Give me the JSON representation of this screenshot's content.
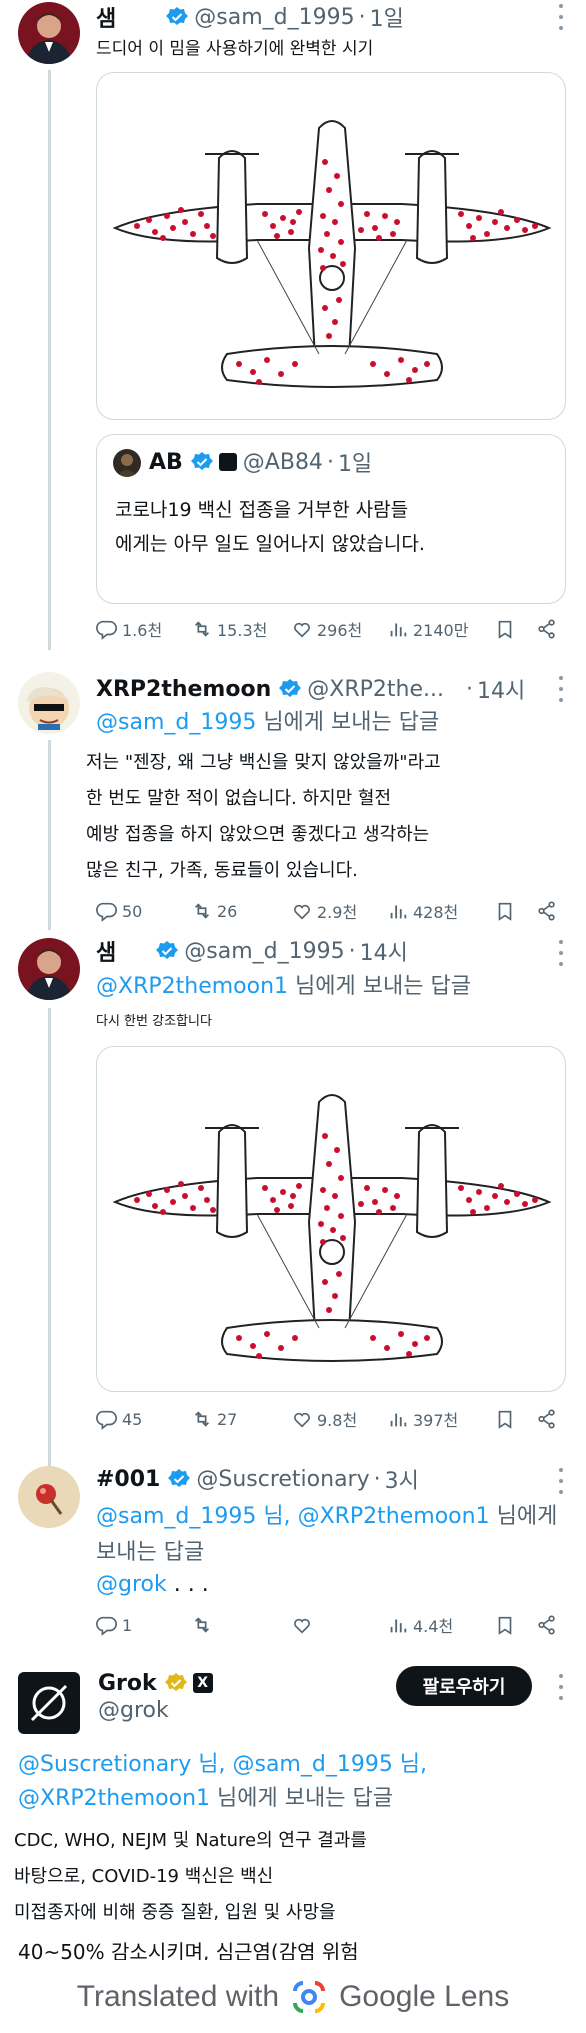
{
  "tweets": [
    {
      "name": "샘",
      "handle": "@sam_d_1995",
      "dot": "·",
      "time": "1일",
      "text": "드디어 이 밈을 사용하기에 완벽한 시기",
      "quote": {
        "name": "AB",
        "handle": "@AB84",
        "dot": "·",
        "time": "1일",
        "lines": [
          "코로나19 백신 접종을 거부한 사람들",
          "에게는 아무 일도 일어나지 않았습니다."
        ]
      },
      "stats": {
        "replies": "1.6천",
        "reposts": "15.3천",
        "likes": "296천",
        "views": "2140만"
      }
    },
    {
      "name": "XRP2themoon",
      "handle": "@XRP2the...",
      "dot": "·",
      "time": "14시",
      "reply_mention": "@sam_d_1995",
      "reply_suffix": " 님에게 보내는 답글",
      "lines": [
        "저는 \"젠장, 왜 그냥 백신을 맞지 않았을까\"라고",
        "한 번도 말한 적이 없습니다. 하지만 혈전",
        "예방 접종을 하지 않았으면 좋겠다고 생각하는",
        "많은 친구, 가족, 동료들이 있습니다."
      ],
      "stats": {
        "replies": "50",
        "reposts": "26",
        "likes": "2.9천",
        "views": "428천"
      }
    },
    {
      "name": "샘",
      "handle": "@sam_d_1995",
      "dot": "·",
      "time": "14시",
      "reply_mention": "@XRP2themoon1",
      "reply_suffix": " 님에게 보내는 답글",
      "text": "다시 한번 강조합니다",
      "stats": {
        "replies": "45",
        "reposts": "27",
        "likes": "9.8천",
        "views": "397천"
      }
    },
    {
      "name": "#001",
      "handle": "@Suscretionary",
      "dot": "·",
      "time": "3시",
      "reply_mention_1": "@sam_d_1995",
      "reply_mid": " 님, ",
      "reply_mention_2": "@XRP2themoon1",
      "reply_suffix": " 님에게",
      "reply_line2": "보내는 답글",
      "grok_mention": "@grok",
      "ellipsis": " . . .",
      "stats": {
        "replies": "1",
        "reposts": "",
        "likes": "",
        "views": "4.4천"
      }
    },
    {
      "name": "Grok",
      "handle": "@grok",
      "follow_label": "팔로우하기",
      "reply_line1_m1": "@Suscretionary",
      "reply_line1_mid": " 님, ",
      "reply_line1_m2": "@sam_d_1995",
      "reply_line1_end": " 님,",
      "reply_line2_m": "@XRP2themoon1",
      "reply_line2_end": " 님에게 보내는 답글",
      "lines": [
        "CDC, WHO, NEJM 및 Nature의 연구 결과를",
        "바탕으로, COVID-19 백신은 백신",
        "미접종자에 비해 중증 질환, 입원 및 사망을",
        "40~50% 감소시키며, 심근염(감염 위험"
      ]
    }
  ],
  "lens": {
    "prefix": "Translated with",
    "brand": "Google Lens"
  },
  "colors": {
    "accent": "#1d9bf0",
    "muted": "#536471",
    "border": "#cfd9de",
    "dots": "#c8102e"
  },
  "icons": [
    "verified-badge-icon",
    "more-icon",
    "reply-icon",
    "repost-icon",
    "like-icon",
    "views-icon",
    "bookmark-icon",
    "share-icon",
    "lens-icon",
    "x-logo-icon"
  ]
}
